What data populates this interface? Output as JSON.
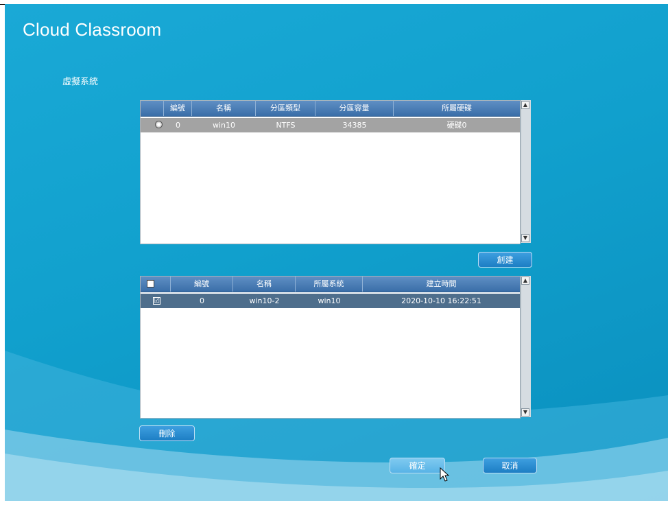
{
  "app": {
    "title": "Cloud Classroom"
  },
  "section": {
    "title": "虛擬系統"
  },
  "partition_table": {
    "columns": [
      "編號",
      "名稱",
      "分區類型",
      "分區容量",
      "所屬硬碟"
    ],
    "rows": [
      {
        "selected": false,
        "id": "0",
        "name": "win10",
        "type": "NTFS",
        "capacity": "34385",
        "disk": "硬碟0"
      }
    ]
  },
  "create_button": {
    "label": "創建"
  },
  "system_table": {
    "columns": [
      "編號",
      "名稱",
      "所屬系統",
      "建立時間"
    ],
    "header_checked": false,
    "rows": [
      {
        "checked": true,
        "check_glyph": "☑",
        "id": "0",
        "name": "win10-2",
        "system": "win10",
        "created": "2020-10-10 16:22:51"
      }
    ]
  },
  "delete_button": {
    "label": "刪除"
  },
  "confirm_button": {
    "label": "確定"
  },
  "cancel_button": {
    "label": "取消"
  },
  "colors": {
    "background": "#11a0cd",
    "header": "#3a6ea8",
    "selected_row_gray": "#a3a3a3",
    "selected_row_dark": "#4e6e8c"
  },
  "icons": [
    "radio-icon",
    "checkbox-icon",
    "scroll-up-icon",
    "scroll-down-icon",
    "mouse-cursor-icon"
  ]
}
